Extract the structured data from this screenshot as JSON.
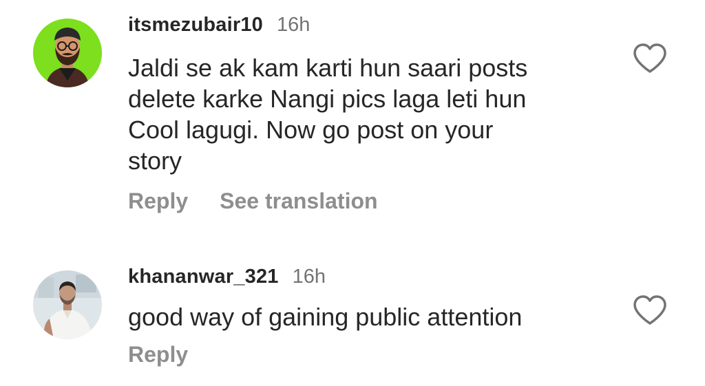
{
  "comments": [
    {
      "username": "itsmezubair10",
      "timestamp": "16h",
      "text": "Jaldi se ak kam karti hun saari posts\ndelete karke Nangi pics laga leti hun\nCool lagugi. Now go post on your\nstory",
      "actions": [
        "Reply",
        "See translation"
      ],
      "avatar_icon": "cartoon-avatar-icon",
      "avatar_bg": "#7ddf1e"
    },
    {
      "username": "khananwar_321",
      "timestamp": "16h",
      "text": "good way of gaining public attention",
      "actions": [
        "Reply"
      ],
      "avatar_icon": "profile-photo-icon",
      "avatar_bg": "#dfe6ea"
    }
  ],
  "like_icon": "heart-outline-icon"
}
